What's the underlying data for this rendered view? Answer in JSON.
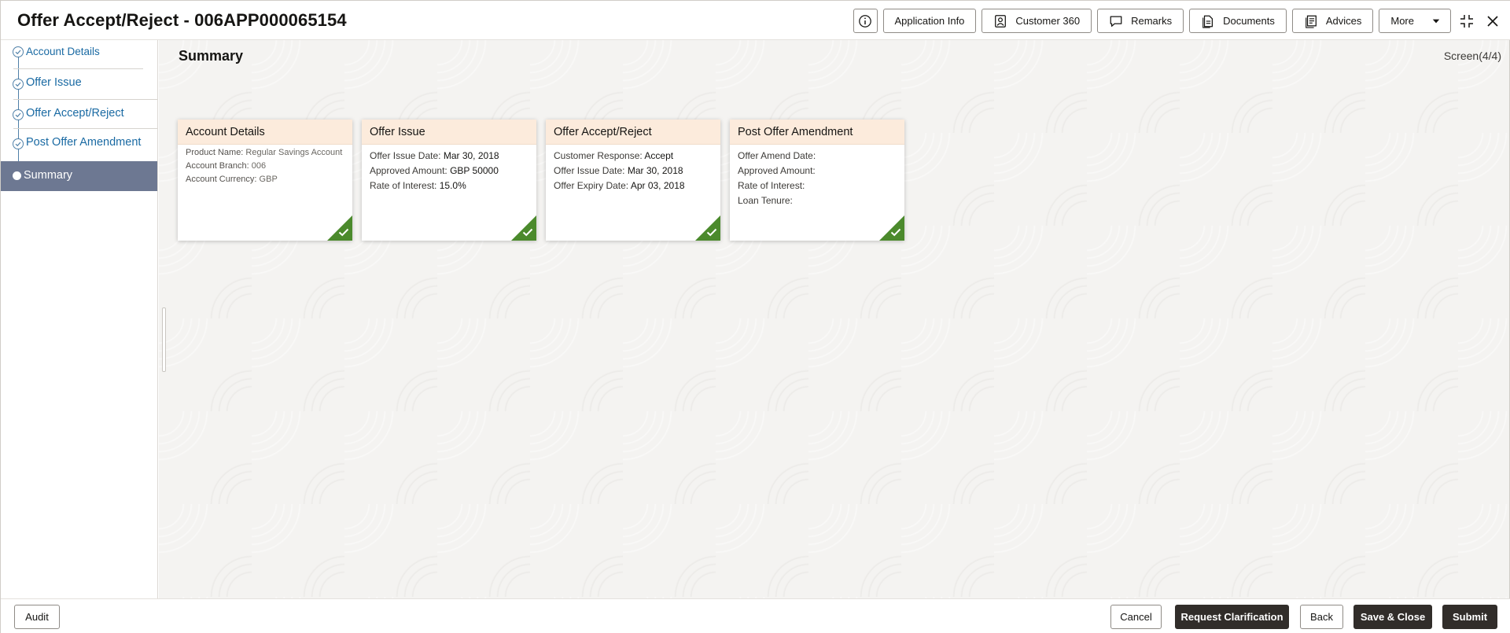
{
  "header": {
    "title": "Offer Accept/Reject - 006APP000065154",
    "buttons": {
      "application_info": "Application Info",
      "customer_360": "Customer 360",
      "remarks": "Remarks",
      "documents": "Documents",
      "advices": "Advices",
      "more": "More"
    }
  },
  "sidebar": {
    "steps": [
      {
        "label": "Account Details",
        "status": "done"
      },
      {
        "label": "Offer Issue",
        "status": "done"
      },
      {
        "label": "Offer Accept/Reject",
        "status": "done"
      },
      {
        "label": "Post Offer Amendment",
        "status": "done"
      },
      {
        "label": "Summary",
        "status": "active"
      }
    ]
  },
  "main": {
    "title": "Summary",
    "screen": "Screen(4/4)",
    "cards": {
      "account_details": {
        "title": "Account Details",
        "product_name_label": "Product Name: ",
        "product_name_value": "Regular Savings Account",
        "branch_label": "Account Branch: ",
        "branch_value": "006",
        "currency_label": "Account Currency: ",
        "currency_value": "GBP"
      },
      "offer_issue": {
        "title": "Offer Issue",
        "issue_date_label": "Offer Issue Date: ",
        "issue_date_value": "Mar 30, 2018",
        "approved_amount_label": "Approved Amount: ",
        "approved_amount_value": "GBP 50000",
        "rate_label": "Rate of Interest: ",
        "rate_value": "15.0%"
      },
      "offer_accept_reject": {
        "title": "Offer Accept/Reject",
        "response_label": "Customer Response: ",
        "response_value": "Accept",
        "issue_date_label": "Offer Issue Date: ",
        "issue_date_value": "Mar 30, 2018",
        "expiry_date_label": "Offer Expiry Date: ",
        "expiry_date_value": "Apr 03, 2018"
      },
      "post_offer_amendment": {
        "title": "Post Offer Amendment",
        "amend_date_label": "Offer Amend Date:",
        "approved_amount_label": "Approved Amount:",
        "rate_label": "Rate of Interest:",
        "loan_tenure_label": "Loan Tenure:"
      }
    }
  },
  "footer": {
    "audit": "Audit",
    "cancel": "Cancel",
    "request_clarification": "Request Clarification",
    "back": "Back",
    "save_close": "Save & Close",
    "submit": "Submit"
  },
  "colors": {
    "card_header": "#fcebdc",
    "done_badge": "#4b8a2c",
    "active_step": "#6d7892",
    "link": "#1a6aa3",
    "primary_button": "#312d2a"
  },
  "icons": [
    "info-icon",
    "customer-icon",
    "remarks-icon",
    "documents-icon",
    "advices-icon",
    "caret-down-icon",
    "minimize-icon",
    "close-icon",
    "check-icon"
  ]
}
